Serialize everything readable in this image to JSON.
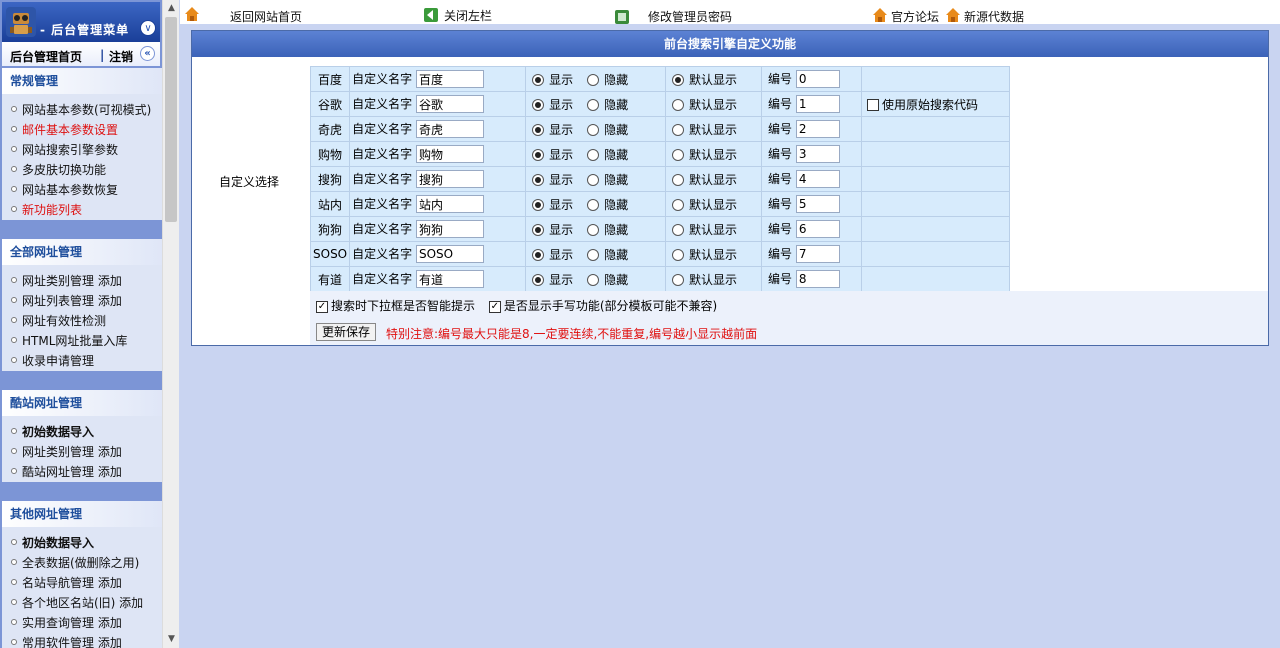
{
  "sidebar": {
    "title": "后台管理菜单",
    "home_label": "后台管理首页",
    "logout_label": "注销",
    "groups": [
      {
        "title": "常规管理",
        "items": [
          {
            "label": "网站基本参数(可视模式)",
            "style": "normal"
          },
          {
            "label": "邮件基本参数设置",
            "style": "red"
          },
          {
            "label": "网站搜索引擎参数",
            "style": "normal"
          },
          {
            "label": "多皮肤切换功能",
            "style": "normal"
          },
          {
            "label": "网站基本参数恢复",
            "style": "normal"
          },
          {
            "label": "新功能列表",
            "style": "red"
          }
        ]
      },
      {
        "title": "全部网址管理",
        "items": [
          {
            "label": "网址类别管理  添加",
            "style": "normal"
          },
          {
            "label": "网址列表管理  添加",
            "style": "normal"
          },
          {
            "label": "网址有效性检测",
            "style": "normal"
          },
          {
            "label": "HTML网址批量入库",
            "style": "normal"
          },
          {
            "label": "收录申请管理",
            "style": "normal"
          }
        ]
      },
      {
        "title": "酷站网址管理",
        "items": [
          {
            "label": "初始数据导入",
            "style": "bold"
          },
          {
            "label": "网址类别管理  添加",
            "style": "normal"
          },
          {
            "label": "酷站网址管理  添加",
            "style": "normal"
          }
        ]
      },
      {
        "title": "其他网址管理",
        "items": [
          {
            "label": "初始数据导入",
            "style": "bold"
          },
          {
            "label": "全表数据(做删除之用)",
            "style": "normal"
          },
          {
            "label": "名站导航管理  添加",
            "style": "normal"
          },
          {
            "label": "各个地区名站(旧)  添加",
            "style": "normal"
          },
          {
            "label": "实用查询管理  添加",
            "style": "normal"
          },
          {
            "label": "常用软件管理  添加",
            "style": "normal"
          }
        ]
      }
    ]
  },
  "topbar": {
    "back_home": "返回网站首页",
    "close_left": "关闭左栏",
    "change_password": "修改管理员密码",
    "forum": "官方论坛",
    "new_data": "新源代数据"
  },
  "panel": {
    "title": "前台搜索引擎自定义功能",
    "left_label": "自定义选择",
    "name_prefix": "自定义名字",
    "show_label": "显示",
    "hide_label": "隐藏",
    "default_label": "默认显示",
    "number_label": "编号",
    "original_code_label": "使用原始搜索代码",
    "rows": [
      {
        "label": "百度",
        "name": "百度",
        "number": "0",
        "show": true,
        "default": true
      },
      {
        "label": "谷歌",
        "name": "谷歌",
        "number": "1",
        "show": true,
        "default": false
      },
      {
        "label": "奇虎",
        "name": "奇虎",
        "number": "2",
        "show": true,
        "default": false
      },
      {
        "label": "购物",
        "name": "购物",
        "number": "3",
        "show": true,
        "default": false
      },
      {
        "label": "搜狗",
        "name": "搜狗",
        "number": "4",
        "show": true,
        "default": false
      },
      {
        "label": "站内",
        "name": "站内",
        "number": "5",
        "show": true,
        "default": false
      },
      {
        "label": "狗狗",
        "name": "狗狗",
        "number": "6",
        "show": true,
        "default": false
      },
      {
        "label": "SOSO",
        "name": "SOSO",
        "number": "7",
        "show": true,
        "default": false
      },
      {
        "label": "有道",
        "name": "有道",
        "number": "8",
        "show": true,
        "default": false
      }
    ],
    "option_smart_hint": "搜索时下拉框是否智能提示",
    "option_handwrite": "是否显示手写功能(部分模板可能不兼容)",
    "save_label": "更新保存",
    "notice": "特别注意:编号最大只能是8,一定要连续,不能重复,编号越小显示越前面"
  },
  "icons": {
    "home": "home-icon",
    "close": "close-left-icon",
    "password": "password-icon",
    "forum": "forum-icon",
    "data": "data-icon"
  }
}
